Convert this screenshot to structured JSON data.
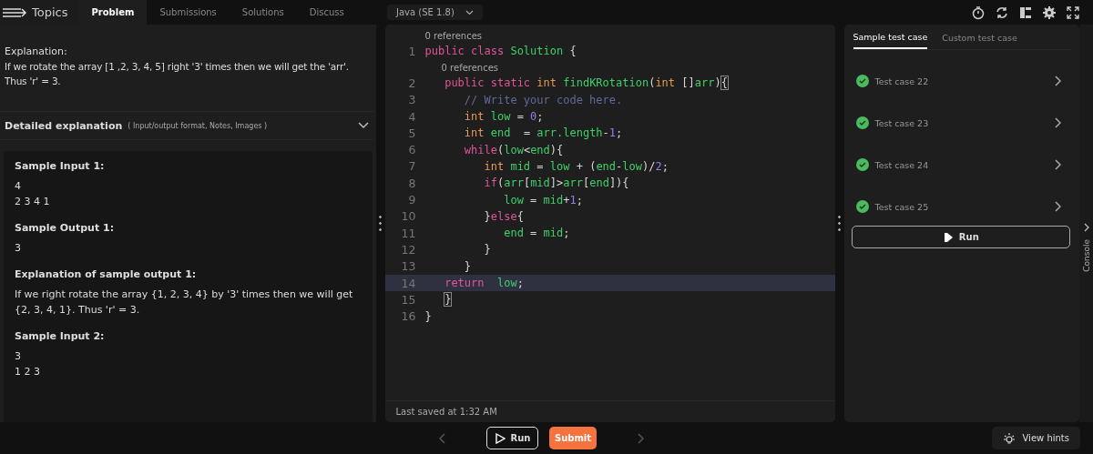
{
  "top_tabs": [
    {
      "label": "Topics",
      "kind": "menu"
    },
    {
      "label": "Problem",
      "selected": true
    },
    {
      "label": "Submissions",
      "selected": false
    },
    {
      "label": "Solutions",
      "selected": false
    },
    {
      "label": "Discuss",
      "selected": false
    }
  ],
  "problem": {
    "explanation_title": "Explanation:",
    "explanation_text": "If we rotate the array [1 ,2, 3, 4, 5] right '3' times then we will get the 'arr'. Thus 'r' = 3.",
    "detailed_title": "Detailed explanation",
    "detailed_hint": "( Input/output format, Notes, Images )",
    "expanded": false,
    "samples": [
      {
        "heading": "Sample Input 1:",
        "lines": [
          "4",
          "2 3 4 1"
        ]
      },
      {
        "heading": "Sample Output 1:",
        "lines": [
          "3"
        ]
      },
      {
        "heading": "Explanation of sample output 1:",
        "lines": [
          "If we right rotate the array {1, 2, 3, 4} by '3' times then we will get {2, 3, 4, 1}. Thus 'r' = 3."
        ]
      },
      {
        "heading": "Sample Input 2:",
        "lines": [
          "3",
          "1 2 3"
        ]
      }
    ]
  },
  "editor": {
    "language": "Java (SE 1.8)",
    "last_saved": "Last saved at 1:32 AM",
    "lines": [
      {
        "number": "1",
        "references": "0 references",
        "highlighted": false,
        "tokens": [
          {
            "kind": "kw",
            "text": "public class "
          },
          {
            "kind": "id",
            "text": "Solution "
          },
          {
            "kind": "p",
            "text": "{"
          }
        ]
      },
      {
        "number": "2",
        "references": "0 references",
        "highlighted": false,
        "tokens": [
          {
            "kind": "kw",
            "text": "   public static "
          },
          {
            "kind": "ty",
            "text": "int "
          },
          {
            "kind": "id",
            "text": "findKRotation"
          },
          {
            "kind": "p",
            "text": "("
          },
          {
            "kind": "ty",
            "text": "int "
          },
          {
            "kind": "p",
            "text": "[]"
          },
          {
            "kind": "id",
            "text": "arr"
          },
          {
            "kind": "p",
            "text": ")"
          },
          {
            "kind": "match",
            "text": "{"
          }
        ]
      },
      {
        "number": "3",
        "highlighted": false,
        "tokens": [
          {
            "kind": "cm",
            "text": "      // Write your code here."
          }
        ]
      },
      {
        "number": "4",
        "highlighted": false,
        "tokens": [
          {
            "kind": "ty",
            "text": "      int "
          },
          {
            "kind": "id",
            "text": "low "
          },
          {
            "kind": "p",
            "text": "= "
          },
          {
            "kind": "num",
            "text": "0"
          },
          {
            "kind": "p",
            "text": ";"
          }
        ]
      },
      {
        "number": "5",
        "highlighted": false,
        "tokens": [
          {
            "kind": "ty",
            "text": "      int "
          },
          {
            "kind": "id",
            "text": "end  "
          },
          {
            "kind": "p",
            "text": "= "
          },
          {
            "kind": "id",
            "text": "arr.length"
          },
          {
            "kind": "p",
            "text": "-"
          },
          {
            "kind": "num",
            "text": "1"
          },
          {
            "kind": "p",
            "text": ";"
          }
        ]
      },
      {
        "number": "6",
        "highlighted": false,
        "tokens": [
          {
            "kind": "kw",
            "text": "      while"
          },
          {
            "kind": "p",
            "text": "("
          },
          {
            "kind": "id",
            "text": "low"
          },
          {
            "kind": "p",
            "text": "<"
          },
          {
            "kind": "id",
            "text": "end"
          },
          {
            "kind": "p",
            "text": "){"
          }
        ]
      },
      {
        "number": "7",
        "highlighted": false,
        "tokens": [
          {
            "kind": "ty",
            "text": "         int "
          },
          {
            "kind": "id",
            "text": "mid "
          },
          {
            "kind": "p",
            "text": "= "
          },
          {
            "kind": "id",
            "text": "low "
          },
          {
            "kind": "p",
            "text": "+ ("
          },
          {
            "kind": "id",
            "text": "end"
          },
          {
            "kind": "p",
            "text": "-"
          },
          {
            "kind": "id",
            "text": "low"
          },
          {
            "kind": "p",
            "text": ")/"
          },
          {
            "kind": "num",
            "text": "2"
          },
          {
            "kind": "p",
            "text": ";"
          }
        ]
      },
      {
        "number": "8",
        "highlighted": false,
        "tokens": [
          {
            "kind": "kw",
            "text": "         if"
          },
          {
            "kind": "p",
            "text": "("
          },
          {
            "kind": "id",
            "text": "arr"
          },
          {
            "kind": "p",
            "text": "["
          },
          {
            "kind": "id",
            "text": "mid"
          },
          {
            "kind": "p",
            "text": "]>"
          },
          {
            "kind": "id",
            "text": "arr"
          },
          {
            "kind": "p",
            "text": "["
          },
          {
            "kind": "id",
            "text": "end"
          },
          {
            "kind": "p",
            "text": "]){"
          }
        ]
      },
      {
        "number": "9",
        "highlighted": false,
        "tokens": [
          {
            "kind": "id",
            "text": "            low "
          },
          {
            "kind": "p",
            "text": "= "
          },
          {
            "kind": "id",
            "text": "mid"
          },
          {
            "kind": "p",
            "text": "+"
          },
          {
            "kind": "num",
            "text": "1"
          },
          {
            "kind": "p",
            "text": ";"
          }
        ]
      },
      {
        "number": "10",
        "highlighted": false,
        "tokens": [
          {
            "kind": "p",
            "text": "         }"
          },
          {
            "kind": "kw",
            "text": "else"
          },
          {
            "kind": "p",
            "text": "{"
          }
        ]
      },
      {
        "number": "11",
        "highlighted": false,
        "tokens": [
          {
            "kind": "id",
            "text": "            end "
          },
          {
            "kind": "p",
            "text": "= "
          },
          {
            "kind": "id",
            "text": "mid"
          },
          {
            "kind": "p",
            "text": ";"
          }
        ]
      },
      {
        "number": "12",
        "highlighted": false,
        "tokens": [
          {
            "kind": "p",
            "text": "         }"
          }
        ]
      },
      {
        "number": "13",
        "highlighted": false,
        "tokens": [
          {
            "kind": "p",
            "text": "      }"
          }
        ]
      },
      {
        "number": "14",
        "highlighted": true,
        "tokens": [
          {
            "kind": "kw",
            "text": "   return  "
          },
          {
            "kind": "id",
            "text": "low"
          },
          {
            "kind": "p",
            "text": ";"
          }
        ]
      },
      {
        "number": "15",
        "highlighted": false,
        "tokens": [
          {
            "kind": "match",
            "text": "   }"
          }
        ]
      },
      {
        "number": "16",
        "highlighted": false,
        "tokens": [
          {
            "kind": "p",
            "text": "}"
          }
        ]
      }
    ]
  },
  "tests": {
    "tabs": [
      {
        "label": "Sample test case",
        "selected": true
      },
      {
        "label": "Custom test case",
        "selected": false
      }
    ],
    "cases": [
      {
        "label": "Test case 22",
        "passed": true
      },
      {
        "label": "Test case 23",
        "passed": true
      },
      {
        "label": "Test case 24",
        "passed": true
      },
      {
        "label": "Test case 25",
        "passed": true
      }
    ],
    "run_label": "Run",
    "console_label": "Console"
  },
  "footer": {
    "run": "Run",
    "submit": "Submit",
    "hints": "View hints"
  }
}
